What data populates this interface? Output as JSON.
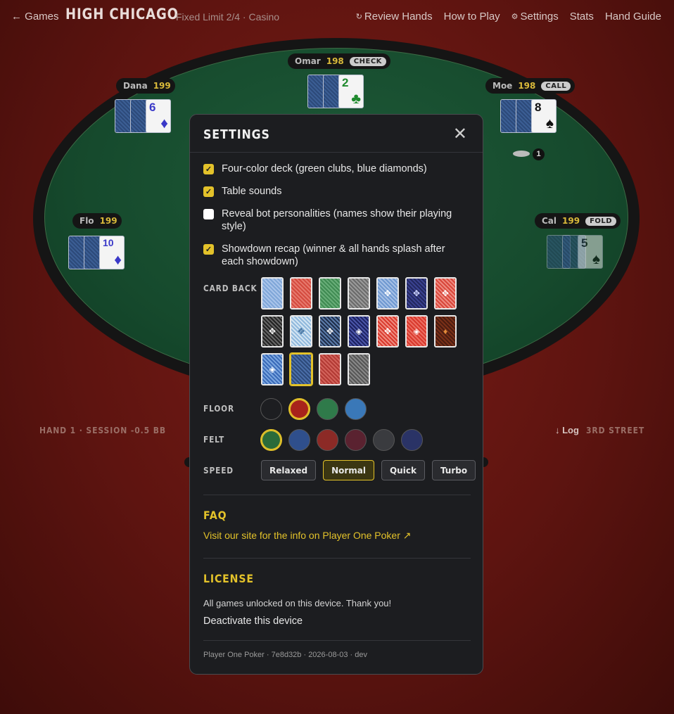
{
  "topbar": {
    "back_label": "← Games",
    "title": "HIGH CHICAGO",
    "subtitle": "Fixed Limit 2/4 · Casino",
    "nav": [
      {
        "icon": "↻",
        "label": "Review Hands"
      },
      {
        "icon": "",
        "label": "How to Play"
      },
      {
        "icon": "⚙",
        "label": "Settings"
      },
      {
        "icon": "",
        "label": "Stats"
      },
      {
        "icon": "",
        "label": "Hand Guide"
      }
    ]
  },
  "players": {
    "omar": {
      "name": "Omar",
      "chips": "198",
      "tag": "CHECK",
      "card_rank": "2",
      "card_suit": "♣"
    },
    "dana": {
      "name": "Dana",
      "chips": "199",
      "card_rank": "6",
      "card_suit": "♦"
    },
    "moe": {
      "name": "Moe",
      "chips": "198",
      "tag": "CALL",
      "card_rank": "8",
      "card_suit": "♠",
      "bet_count": "1"
    },
    "flo": {
      "name": "Flo",
      "chips": "199",
      "card_rank": "10",
      "card_suit": "♦"
    },
    "cal": {
      "name": "Cal",
      "chips": "199",
      "tag": "FOLD",
      "card_rank": "5",
      "card_suit": "♠"
    }
  },
  "status": {
    "hand_info": "HAND 1 · SESSION -0.5 BB",
    "log_label": "↓ Log",
    "street": "3RD STREET"
  },
  "settings": {
    "title": "SETTINGS",
    "close_icon": "✕",
    "options": [
      {
        "label": "Four-color deck (green clubs, blue diamonds)",
        "checked": true
      },
      {
        "label": "Table sounds",
        "checked": true
      },
      {
        "label": "Reveal bot personalities (names show their playing style)",
        "checked": false
      },
      {
        "label": "Showdown recap (winner & all hands splash after each showdown)",
        "checked": true
      }
    ],
    "card_back_label": "CARD BACK",
    "card_backs_selected_index": 15,
    "floor_label": "FLOOR",
    "floor_colors": [
      "#1d1e21",
      "#a8231b",
      "#2f7a4a",
      "#3a78b8"
    ],
    "floor_selected_index": 1,
    "felt_label": "FELT",
    "felt_colors": [
      "#2b6b3a",
      "#2f4f8c",
      "#8c2a26",
      "#5a2230",
      "#3a3b3f",
      "#2a3366"
    ],
    "felt_selected_index": 0,
    "speed_label": "SPEED",
    "speeds": [
      "Relaxed",
      "Normal",
      "Quick",
      "Turbo"
    ],
    "speed_selected_index": 1,
    "faq_heading": "FAQ",
    "faq_link": "Visit our site for the info on Player One Poker ↗",
    "license_heading": "LICENSE",
    "license_text": "All games unlocked on this device. Thank you!",
    "deactivate_label": "Deactivate this device",
    "footer": "Player One Poker · 7e8d32b · 2026-08-03 · dev"
  },
  "colors": {
    "accent": "#e3c22a",
    "modal_bg": "#1c1d20",
    "felt": "#1e5a38",
    "floor": "#5e1410"
  }
}
